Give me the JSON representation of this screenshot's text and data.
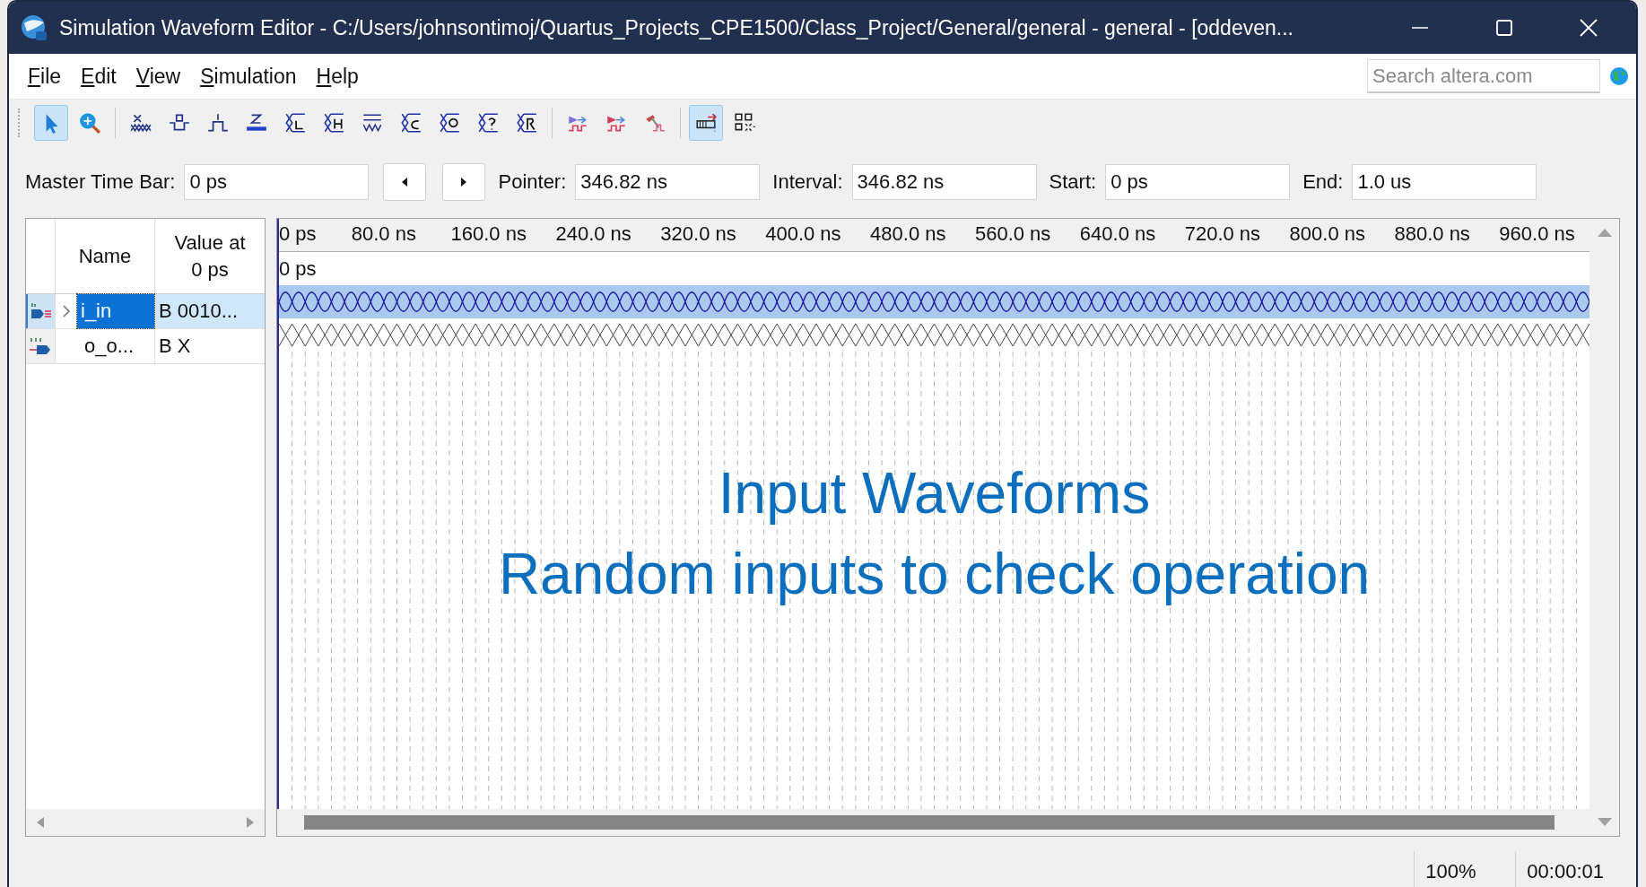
{
  "window": {
    "title": "Simulation Waveform Editor - C:/Users/johnsontimoj/Quartus_Projects_CPE1500/Class_Project/General/general - general - [oddeven..."
  },
  "menu": [
    "File",
    "Edit",
    "View",
    "Simulation",
    "Help"
  ],
  "search": {
    "placeholder": "Search altera.com"
  },
  "toolbar": [
    {
      "kind": "pointer",
      "selected": true
    },
    {
      "kind": "zoom",
      "selected": false
    },
    {
      "kind": "separator"
    },
    {
      "kind": "unknown",
      "selected": false
    },
    {
      "kind": "low",
      "selected": false
    },
    {
      "kind": "high",
      "selected": false
    },
    {
      "kind": "hiz",
      "selected": false
    },
    {
      "kind": "weak_low",
      "selected": false
    },
    {
      "kind": "weak_high",
      "selected": false
    },
    {
      "kind": "invert",
      "selected": false
    },
    {
      "kind": "count",
      "selected": false
    },
    {
      "kind": "clock",
      "selected": false
    },
    {
      "kind": "random",
      "selected": false
    },
    {
      "kind": "value",
      "selected": false
    },
    {
      "kind": "separator"
    },
    {
      "kind": "run_functional",
      "selected": false
    },
    {
      "kind": "run_timing",
      "selected": false
    },
    {
      "kind": "netlist",
      "selected": false
    },
    {
      "kind": "separator"
    },
    {
      "kind": "snap",
      "selected": true
    },
    {
      "kind": "group",
      "selected": false
    }
  ],
  "time_bar": [
    {
      "kind": "field",
      "label": "Master Time Bar:",
      "value": "0 ps"
    },
    {
      "kind": "previous"
    },
    {
      "kind": "next"
    },
    {
      "kind": "field",
      "label": "Pointer:",
      "value": "346.82 ns"
    },
    {
      "kind": "field",
      "label": "Interval:",
      "value": "346.82 ns"
    },
    {
      "kind": "field",
      "label": "Start:",
      "value": "0 ps"
    },
    {
      "kind": "field",
      "label": "End:",
      "value": "1.0 us"
    }
  ],
  "signal_header": {
    "name": "Name",
    "value": "Value at 0 ps"
  },
  "signals": [
    {
      "kind": "input",
      "expandable": true,
      "name": "i_in",
      "value": "B 0010...",
      "selected": true
    },
    {
      "kind": "output",
      "expandable": false,
      "name": "o_o...",
      "value": "B X",
      "selected": false
    }
  ],
  "ruler": {
    "labels": [
      "0 ps",
      "80.0 ns",
      "160.0 ns",
      "240.0 ns",
      "320.0 ns",
      "400.0 ns",
      "480.0 ns",
      "560.0 ns",
      "640.0 ns",
      "720.0 ns",
      "800.0 ns",
      "880.0 ns",
      "960.0 ns"
    ],
    "cursor_label": "0 ps"
  },
  "annotation": [
    "Input Waveforms",
    "Random inputs to check operation"
  ],
  "status_bar": {
    "zoom": "100%",
    "time": "00:00:01"
  }
}
